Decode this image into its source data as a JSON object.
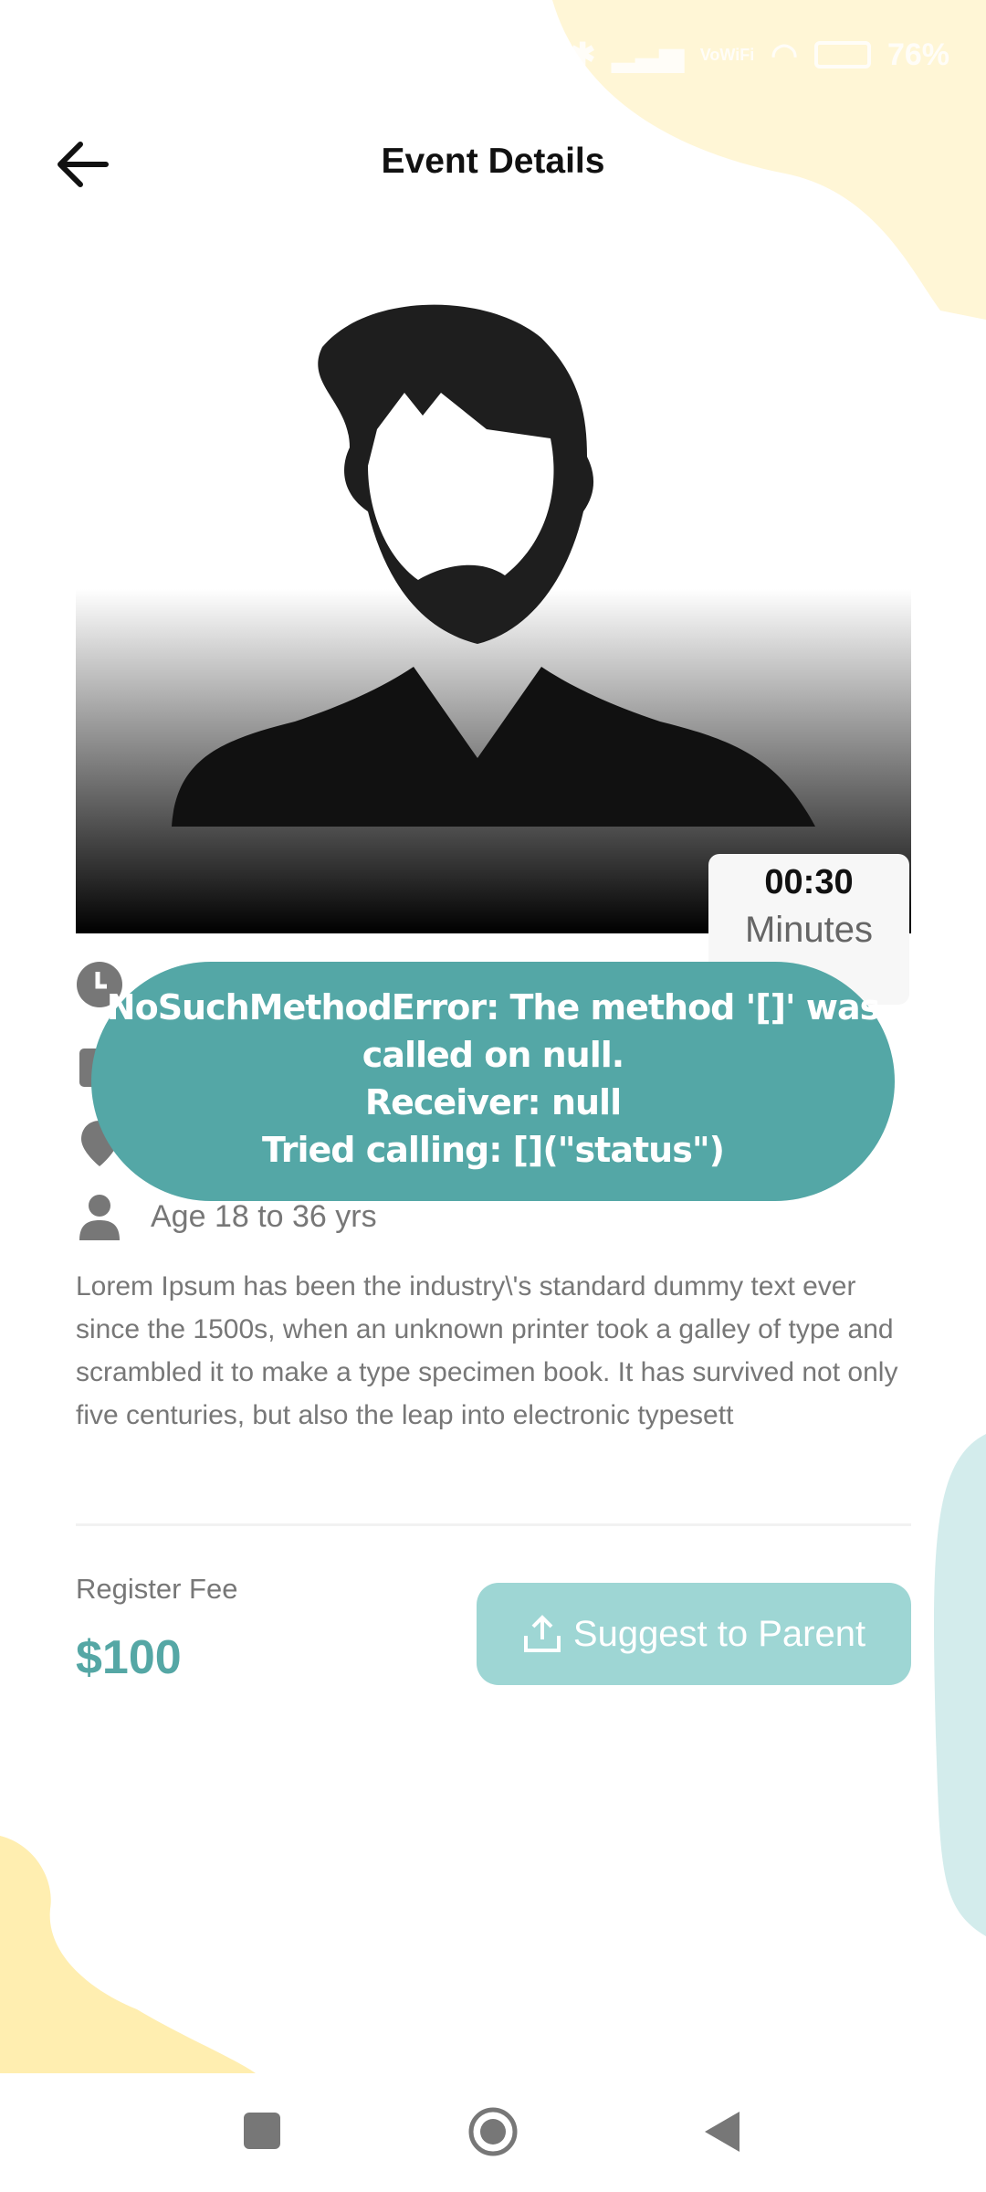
{
  "status_bar": {
    "battery": "76%",
    "icons": [
      "bluetooth-icon",
      "signal-icon",
      "vowifi-icon",
      "signal-icon",
      "wifi-icon",
      "battery-icon"
    ]
  },
  "header": {
    "title": "Event Details",
    "back_icon": "arrow-left-icon"
  },
  "hero": {
    "image": "person-placeholder"
  },
  "timer": {
    "value": "00:30",
    "unit": "Minutes"
  },
  "details": {
    "age": "Age 18 to 36 yrs"
  },
  "description": "Lorem Ipsum has been the industry\\'s standard dummy text ever since the 1500s, when an unknown printer took a galley of type and scrambled it to make a type specimen book. It has survived not only five centuries, but also the leap into electronic typesett",
  "fee": {
    "label": "Register Fee",
    "value": "$100"
  },
  "suggest_button": {
    "label": "Suggest to Parent",
    "icon": "share-upload-icon"
  },
  "toast": {
    "line1": "NoSuchMethodError: The method '[]' was",
    "line2": "called on null.",
    "line3": "Receiver: null",
    "line4": "Tried calling: [](\"status\")"
  },
  "colors": {
    "accent": "#55a7a5",
    "button": "#9ed6d4",
    "toast": "#54a7a6",
    "blob_yellow": "#fff6d6",
    "blob_teal": "#d3ecec"
  }
}
